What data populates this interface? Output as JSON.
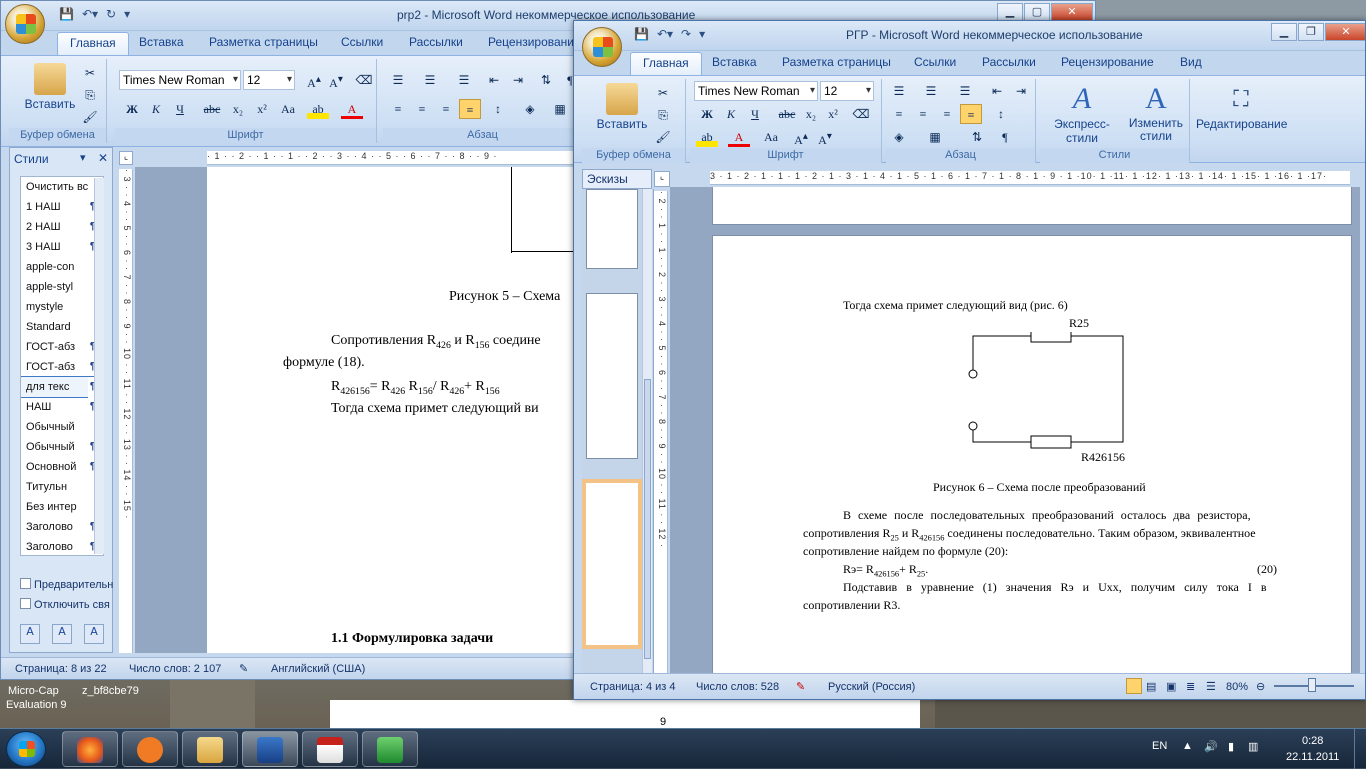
{
  "desktop": {
    "icon_label_1": "Micro-Cap",
    "icon_label_2": "Evaluation 9",
    "icon_label_3": "z_bf8cbe79",
    "page_number_bottom": "9"
  },
  "back_window": {
    "title": "prp2 - Microsoft Word некоммерческое использование",
    "tabs": [
      "Главная",
      "Вставка",
      "Разметка страницы",
      "Ссылки",
      "Рассылки",
      "Рецензирование"
    ],
    "font_name": "Times New Roman",
    "font_size": "12",
    "groups": {
      "clipboard": "Буфер обмена",
      "font": "Шрифт",
      "paragraph": "Абзац"
    },
    "paste_label": "Вставить",
    "styles_pane": {
      "title": "Стили",
      "items": [
        "Очистить вс",
        "1 НАШ",
        "2 НАШ",
        "3 НАШ",
        "apple-con",
        "apple-styl",
        "mystyle",
        "Standard",
        "ГОСТ-абз",
        "ГОСТ-абз",
        "для текс",
        "НАШ",
        "Обычный",
        "Обычный",
        "Основной",
        "Титульн",
        "Без интер",
        "Заголово",
        "Заголово"
      ],
      "markers": [
        "",
        "¶a",
        "¶a",
        "¶a",
        "a",
        "a",
        "¶",
        "¶",
        "¶a",
        "¶a",
        "¶a",
        "¶a",
        "¶",
        "¶a",
        "¶a",
        "¶",
        "¶",
        "¶a",
        "¶a"
      ],
      "check_preview": "Предварительн",
      "check_disable": "Отключить свя"
    },
    "doc": {
      "caption": "Рисунок 5 – Схема",
      "para1_a": "Сопротивления R",
      "para1_s1": "426",
      "para1_b": " и R",
      "para1_s2": "156",
      "para1_c": " соедине",
      "para1_line2": "формуле (18).",
      "formula_a": "R",
      "formula_s1": "426156",
      "formula_b": "= R",
      "formula_s2": "426",
      "formula_c": " R",
      "formula_s3": "156",
      "formula_d": "/ R",
      "formula_s4": "426",
      "formula_e": "+ R",
      "formula_s5": "156",
      "para2": "Тогда схема примет следующий ви",
      "heading": "1.1 Формулировка задачи"
    },
    "status": {
      "page": "Страница: 8 из 22",
      "words": "Число слов: 2 107",
      "lang": "Английский (США)"
    }
  },
  "front_window": {
    "title": "РГР - Microsoft Word некоммерческое использование",
    "tabs": [
      "Главная",
      "Вставка",
      "Разметка страницы",
      "Ссылки",
      "Рассылки",
      "Рецензирование",
      "Вид"
    ],
    "font_name": "Times New Roman",
    "font_size": "12",
    "paste_label": "Вставить",
    "express_styles": "Экспресс-стили",
    "change_styles": "Изменить стили",
    "editing": "Редактирование",
    "groups": {
      "clipboard": "Буфер обмена",
      "font": "Шрифт",
      "paragraph": "Абзац",
      "styles": "Стили"
    },
    "thumbnails_tab": "Эскизы",
    "doc": {
      "intro": "Тогда схема примет следующий вид (рис. 6)",
      "label_r25": "R25",
      "label_r426156": "R426156",
      "caption": "Рисунок 6 – Схема после преобразований",
      "p1_l1": "В схеме после последовательных преобразований осталось два резистора,",
      "p1_l2a": "сопротивления R",
      "p1_l2s1": "25",
      "p1_l2b": " и R",
      "p1_l2s2": "426156",
      "p1_l2c": " соединены последовательно. Таким образом, эквивалентное",
      "p1_l3": "сопротивление найдем по формуле (20):",
      "eq_a": "Rэ= R",
      "eq_s1": "426156",
      "eq_b": "+ R",
      "eq_s2": "25",
      "eq_c": ".",
      "eq_num": "(20)",
      "p2_l1": "Подставив в уравнение (1) значения Rэ и Uxx, получим силу тока I в",
      "p2_l2": "сопротивлении R3."
    },
    "status": {
      "page": "Страница: 4 из 4",
      "words": "Число слов: 528",
      "lang": "Русский (Россия)",
      "zoom": "80%"
    }
  },
  "taskbar": {
    "lang": "EN",
    "time": "0:28",
    "date": "22.11.2011"
  },
  "colors": {
    "ribbon_blue": "#c5d8ee",
    "tab_text": "#15428b",
    "taskbar": "#1f3348"
  }
}
